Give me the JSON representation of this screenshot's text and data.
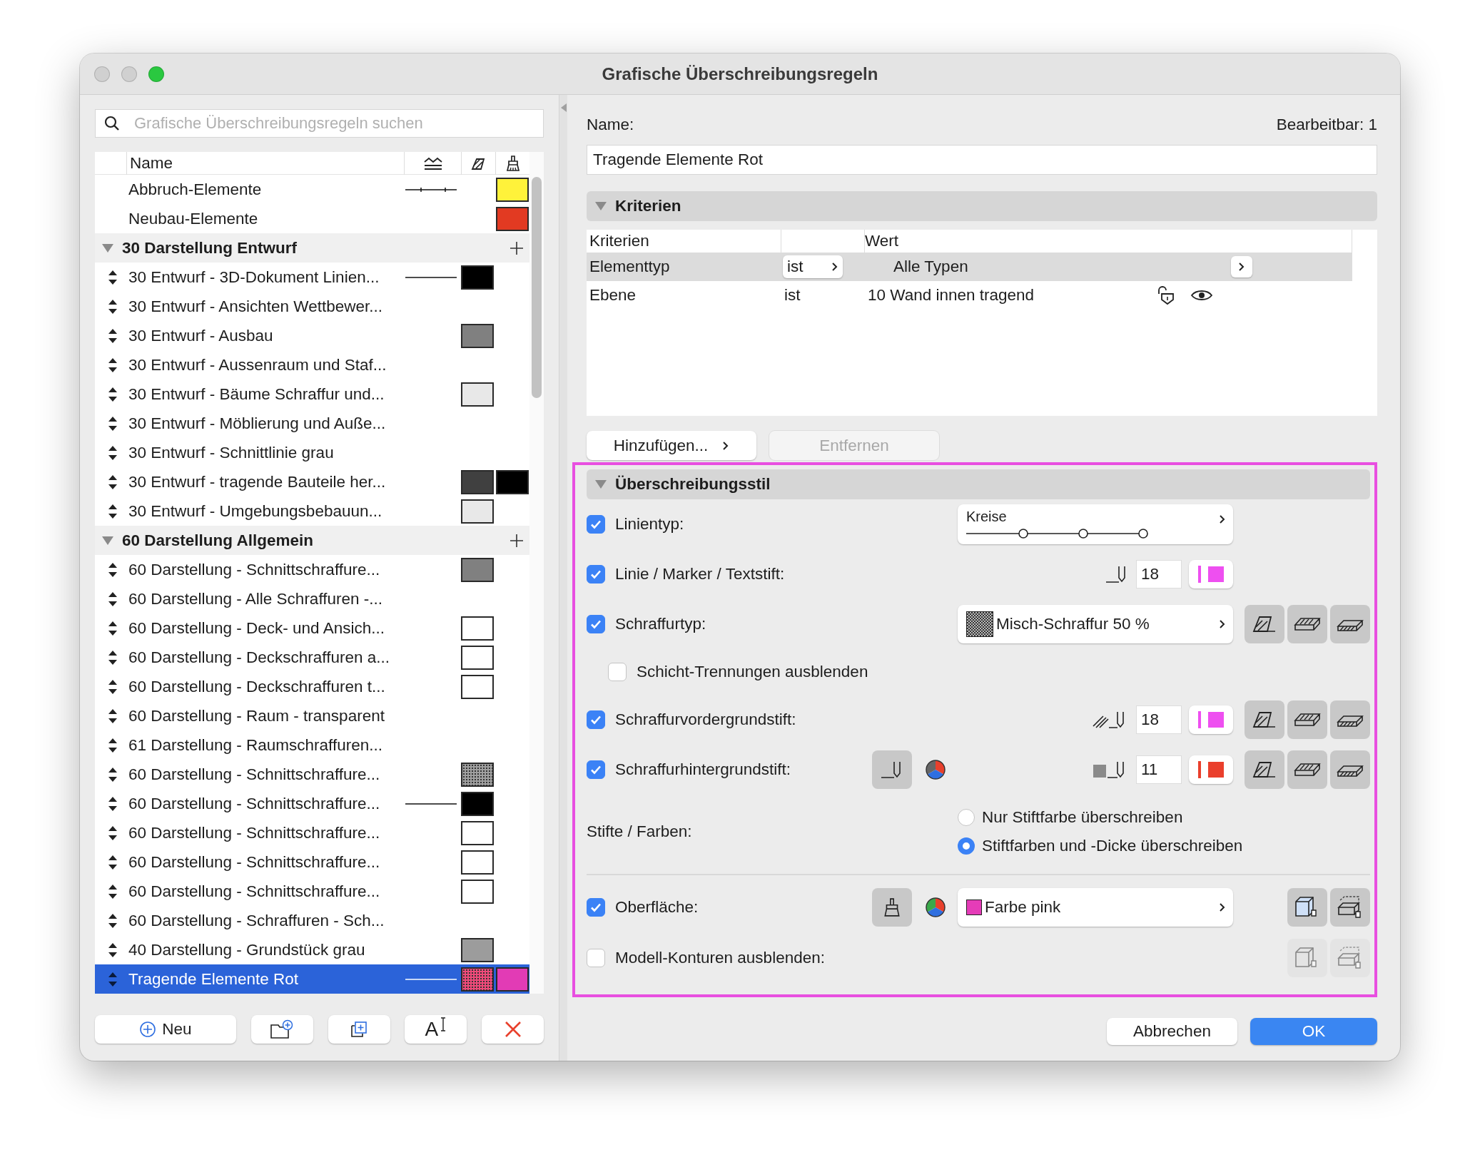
{
  "window": {
    "title": "Grafische Überschreibungsregeln"
  },
  "search": {
    "placeholder": "Grafische Überschreibungsregeln suchen"
  },
  "rules": {
    "column_name": "Name",
    "items": [
      {
        "kind": "rule",
        "name": "Abbruch-Elemente",
        "selected": false,
        "line": true,
        "line_markers": true,
        "surface": {
          "color": "#fff23a"
        }
      },
      {
        "kind": "rule",
        "name": "Neubau-Elemente",
        "selected": false,
        "surface": {
          "color": "#e23a22"
        }
      },
      {
        "kind": "group",
        "name": "30 Darstellung Entwurf",
        "expanded": true,
        "children": [
          {
            "kind": "rule",
            "name": "30 Entwurf - 3D-Dokument Linien...",
            "selected": false,
            "line": true,
            "fill": {
              "color": "#000000"
            }
          },
          {
            "kind": "rule",
            "name": "30 Entwurf - Ansichten Wettbewer...",
            "selected": false
          },
          {
            "kind": "rule",
            "name": "30 Entwurf - Ausbau",
            "selected": false,
            "fill": {
              "color": "#808080"
            }
          },
          {
            "kind": "rule",
            "name": "30 Entwurf - Aussenraum und Staf...",
            "selected": false
          },
          {
            "kind": "rule",
            "name": "30 Entwurf - Bäume Schraffur und...",
            "selected": false,
            "fill": {
              "color": "#e8e8e8"
            }
          },
          {
            "kind": "rule",
            "name": "30 Entwurf - Möblierung und Auße...",
            "selected": false
          },
          {
            "kind": "rule",
            "name": "30 Entwurf - Schnittlinie grau",
            "selected": false
          },
          {
            "kind": "rule",
            "name": "30 Entwurf - tragende Bauteile her...",
            "selected": false,
            "fill": {
              "color": "#404040"
            },
            "surface": {
              "color": "#000000"
            }
          },
          {
            "kind": "rule",
            "name": "30 Entwurf - Umgebungsbebauun...",
            "selected": false,
            "fill": {
              "color": "#e8e8e8"
            }
          }
        ]
      },
      {
        "kind": "group",
        "name": "60 Darstellung Allgemein",
        "expanded": true,
        "children": [
          {
            "kind": "rule",
            "name": "60 Darstellung - Schnittschraffure...",
            "selected": false,
            "fill": {
              "color": "#808080"
            }
          },
          {
            "kind": "rule",
            "name": "60 Darstellung - Alle Schraffuren -...",
            "selected": false
          },
          {
            "kind": "rule",
            "name": "60 Darstellung - Deck- und Ansich...",
            "selected": false,
            "fill": {
              "color": "#ffffff"
            }
          },
          {
            "kind": "rule",
            "name": "60 Darstellung - Deckschraffuren a...",
            "selected": false,
            "fill": {
              "color": "#ffffff"
            }
          },
          {
            "kind": "rule",
            "name": "60 Darstellung - Deckschraffuren t...",
            "selected": false,
            "fill": {
              "color": "#ffffff"
            }
          },
          {
            "kind": "rule",
            "name": "60 Darstellung - Raum - transparent",
            "selected": false
          },
          {
            "kind": "rule",
            "name": "61 Darstellung - Raumschraffuren...",
            "selected": false
          },
          {
            "kind": "rule",
            "name": "60 Darstellung - Schnittschraffure...",
            "selected": false,
            "fill": {
              "color": "#a0a0a0",
              "hatched": true
            }
          },
          {
            "kind": "rule",
            "name": "60 Darstellung - Schnittschraffure...",
            "selected": false,
            "line": true,
            "fill": {
              "color": "#000000"
            }
          },
          {
            "kind": "rule",
            "name": "60 Darstellung - Schnittschraffure...",
            "selected": false,
            "fill": {
              "color": "#ffffff"
            }
          },
          {
            "kind": "rule",
            "name": "60 Darstellung - Schnittschraffure...",
            "selected": false,
            "fill": {
              "color": "#ffffff"
            }
          },
          {
            "kind": "rule",
            "name": "60 Darstellung - Schnittschraffure...",
            "selected": false,
            "fill": {
              "color": "#ffffff"
            }
          },
          {
            "kind": "rule",
            "name": "60 Darstellung - Schraffuren - Sch...",
            "selected": false
          },
          {
            "kind": "rule",
            "name": "40 Darstellung - Grundstück grau",
            "selected": false,
            "fill": {
              "color": "#9c9c9c"
            }
          },
          {
            "kind": "rule",
            "name": "Tragende Elemente Rot",
            "selected": true,
            "line": true,
            "fill": {
              "color": "#f04a7a",
              "hatched": true
            },
            "surface": {
              "color": "#e23bb5"
            }
          }
        ]
      }
    ]
  },
  "list_buttons": [
    {
      "kind": "new",
      "label": "Neu"
    },
    {
      "kind": "new_folder"
    },
    {
      "kind": "duplicate"
    },
    {
      "kind": "rename",
      "glyph": "A"
    },
    {
      "kind": "delete"
    }
  ],
  "editor": {
    "name_label": "Name:",
    "editable": "Bearbeitbar: 1",
    "name_value": "Tragende Elemente Rot"
  },
  "criteria": {
    "title": "Kriterien",
    "expanded": true,
    "columns": {
      "criterion": "Kriterien",
      "value": "Wert"
    },
    "rows": [
      {
        "kind": "popup",
        "criterion": "Elementtyp",
        "operator": "ist",
        "value": "Alle Typen",
        "selected": true
      },
      {
        "kind": "layer",
        "criterion": "Ebene",
        "operator": "ist",
        "value": "10 Wand innen tragend",
        "selected": false
      }
    ],
    "buttons": [
      {
        "label": "Hinzufügen...",
        "disabled": false,
        "menu": true
      },
      {
        "label": "Entfernen",
        "disabled": true,
        "menu": false
      }
    ]
  },
  "override": {
    "title": "Überschreibungsstil",
    "expanded": true,
    "rows": [
      {
        "kind": "line_type",
        "label": "Linientyp:",
        "checked": true,
        "value": "Kreise"
      },
      {
        "kind": "pen",
        "label": "Linie / Marker / Textstift:",
        "checked": true,
        "pen": "18",
        "color": "#ee4ff0"
      },
      {
        "kind": "fill",
        "label": "Schraffurtyp:",
        "checked": true,
        "value": "Misch-Schraffur 50 %"
      },
      {
        "kind": "sub_check",
        "label": "Schicht-Trennungen ausblenden",
        "checked": false
      },
      {
        "kind": "fg_pen",
        "label": "Schraffurvordergrundstift:",
        "checked": true,
        "pen": "18",
        "color": "#ee4ff0"
      },
      {
        "kind": "bg_pen",
        "label": "Schraffurhintergrundstift:",
        "checked": true,
        "pen": "11",
        "color": "#ea3f2c"
      },
      {
        "kind": "radio",
        "label": "Stifte / Farben:",
        "options": [
          {
            "label": "Nur Stiftfarbe überschreiben",
            "selected": false
          },
          {
            "label": "Stiftfarben und -Dicke überschreiben",
            "selected": true
          }
        ]
      },
      {
        "kind": "surface",
        "label": "Oberfläche:",
        "checked": true,
        "value": "Farbe pink",
        "color": "#e53cb8"
      },
      {
        "kind": "contours",
        "label": "Modell-Konturen ausblenden:",
        "checked": false
      }
    ]
  },
  "footer": {
    "cancel": "Abbrechen",
    "ok": "OK"
  }
}
